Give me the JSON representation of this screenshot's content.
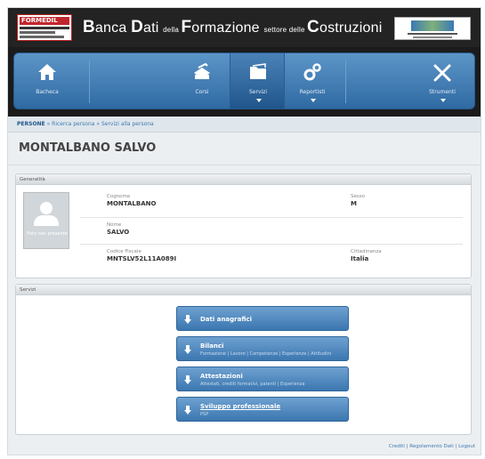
{
  "header": {
    "logo_left": "FORMEDIL",
    "title_parts": [
      {
        "text": "B",
        "cls": "big"
      },
      {
        "text": "anca ",
        "cls": ""
      },
      {
        "text": "D",
        "cls": "big"
      },
      {
        "text": "ati ",
        "cls": ""
      },
      {
        "text": "della ",
        "cls": "small"
      },
      {
        "text": "F",
        "cls": "big"
      },
      {
        "text": "ormazione ",
        "cls": ""
      },
      {
        "text": "settore delle ",
        "cls": "small"
      },
      {
        "text": "C",
        "cls": "big"
      },
      {
        "text": "ostruzioni",
        "cls": ""
      }
    ]
  },
  "nav": {
    "items": [
      {
        "label": "Bacheca",
        "icon": "home-icon"
      },
      {
        "label": "Corsi",
        "icon": "courses-icon"
      },
      {
        "label": "Servizi",
        "icon": "folder-icon"
      },
      {
        "label": "Reportisti",
        "icon": "gears-icon"
      },
      {
        "label": "Strumenti",
        "icon": "tools-icon"
      }
    ]
  },
  "breadcrumb": {
    "root": "PERSONE",
    "items": [
      "» Ricerca persona",
      "» Servizi alla persona"
    ]
  },
  "page": {
    "title": "MONTALBANO SALVO"
  },
  "general": {
    "heading": "Generalità",
    "photo_caption": "Foto non presente",
    "surname_label": "Cognome",
    "surname": "MONTALBANO",
    "sex_label": "Sesso",
    "sex": "M",
    "name_label": "Nome",
    "name": "SALVO",
    "cf_label": "Codice Fiscale",
    "cf": "MNTSLV52L11A089I",
    "citizenship_label": "Cittadinanza",
    "citizenship": "Italia"
  },
  "services": {
    "heading": "Servizi",
    "items": [
      {
        "title": "Dati anagrafici",
        "sub": ""
      },
      {
        "title": "Bilanci",
        "sub": "Formazione | Lavoro | Competenze | Esperienze | Attitudini"
      },
      {
        "title": "Attestazioni",
        "sub": "Attestati, crediti formativi, patenti | Esperienza"
      },
      {
        "title": "Sviluppo professionale",
        "sub": "PSP"
      }
    ]
  },
  "footer": {
    "links": [
      "Crediti",
      "Regolamento Dati",
      "Logout"
    ]
  }
}
